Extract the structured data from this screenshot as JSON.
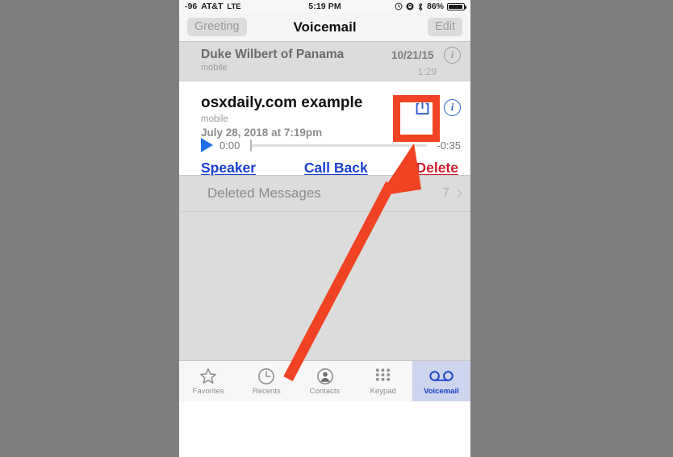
{
  "colors": {
    "accent_blue": "#1a3fd0",
    "danger_red": "#cc2030",
    "annotation_orange": "#f04323",
    "backdrop_gray": "#7f7f7f",
    "dim_row": "#dcdcdc"
  },
  "status_bar": {
    "signal": "-96",
    "carrier": "AT&T",
    "network": "LTE",
    "time": "5:19 PM",
    "battery_percent": "86%",
    "icons": [
      "alarm-clock-icon",
      "rotation-lock-icon",
      "bluetooth-icon",
      "battery-icon"
    ]
  },
  "nav_bar": {
    "left_button": "Greeting",
    "title": "Voicemail",
    "right_button": "Edit"
  },
  "voicemails": [
    {
      "name": "Duke Wilbert of Panama",
      "subtitle": "mobile",
      "date": "10/21/15",
      "duration": "1:29",
      "expanded": false
    },
    {
      "name": "osxdaily.com example",
      "subtitle": "mobile",
      "date": "July 28, 2018 at 7:19pm",
      "expanded": true,
      "player": {
        "current_time": "0:00",
        "remaining_time": "-0:35",
        "progress_percent": 0
      },
      "actions": [
        {
          "label": "Speaker",
          "style": "link"
        },
        {
          "label": "Call Back",
          "style": "link"
        },
        {
          "label": "Delete",
          "style": "danger"
        }
      ],
      "icons": [
        "share-icon",
        "info-icon"
      ]
    }
  ],
  "deleted_messages": {
    "label": "Deleted Messages",
    "count": "7"
  },
  "tab_bar": {
    "tabs": [
      {
        "label": "Favorites",
        "icon": "star-icon",
        "active": false
      },
      {
        "label": "Recents",
        "icon": "clock-icon",
        "active": false
      },
      {
        "label": "Contacts",
        "icon": "person-icon",
        "active": false
      },
      {
        "label": "Keypad",
        "icon": "keypad-icon",
        "active": false
      },
      {
        "label": "Voicemail",
        "icon": "voicemail-icon",
        "active": true
      }
    ]
  },
  "annotation": {
    "type": "arrow-and-highlight-box",
    "target": "share-icon",
    "color": "#f04323"
  }
}
